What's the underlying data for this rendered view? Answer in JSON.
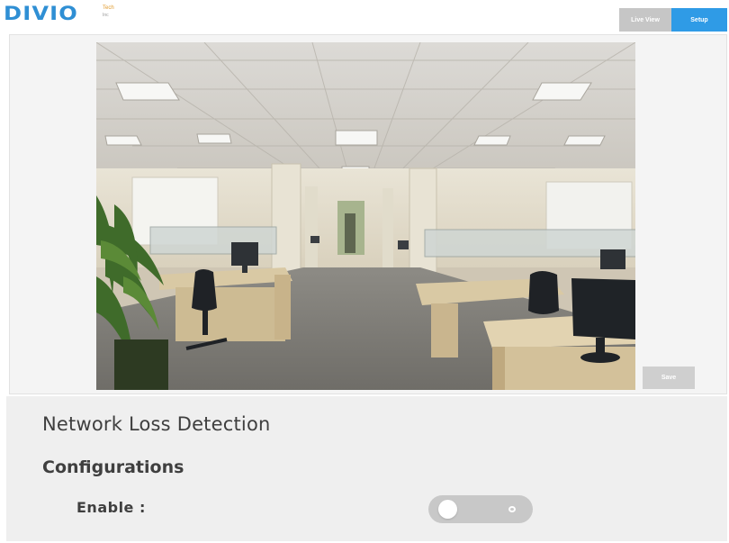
{
  "header": {
    "logo_text": "DIVIO",
    "logo_tagline": "Tech",
    "logo_suffix": "Inc",
    "tabs": [
      {
        "label": "Live View",
        "active": false
      },
      {
        "label": "Setup",
        "active": true
      }
    ]
  },
  "video": {
    "save_label": "Save"
  },
  "settings": {
    "title": "Network Loss Detection",
    "section": "Configurations",
    "enable_label": "Enable :",
    "enable_on": false
  },
  "colors": {
    "brand": "#2f8fd4",
    "tab_active": "#2f9be6",
    "tab_inactive": "#c6c6c6",
    "toggle_off": "#c8c8c8"
  }
}
